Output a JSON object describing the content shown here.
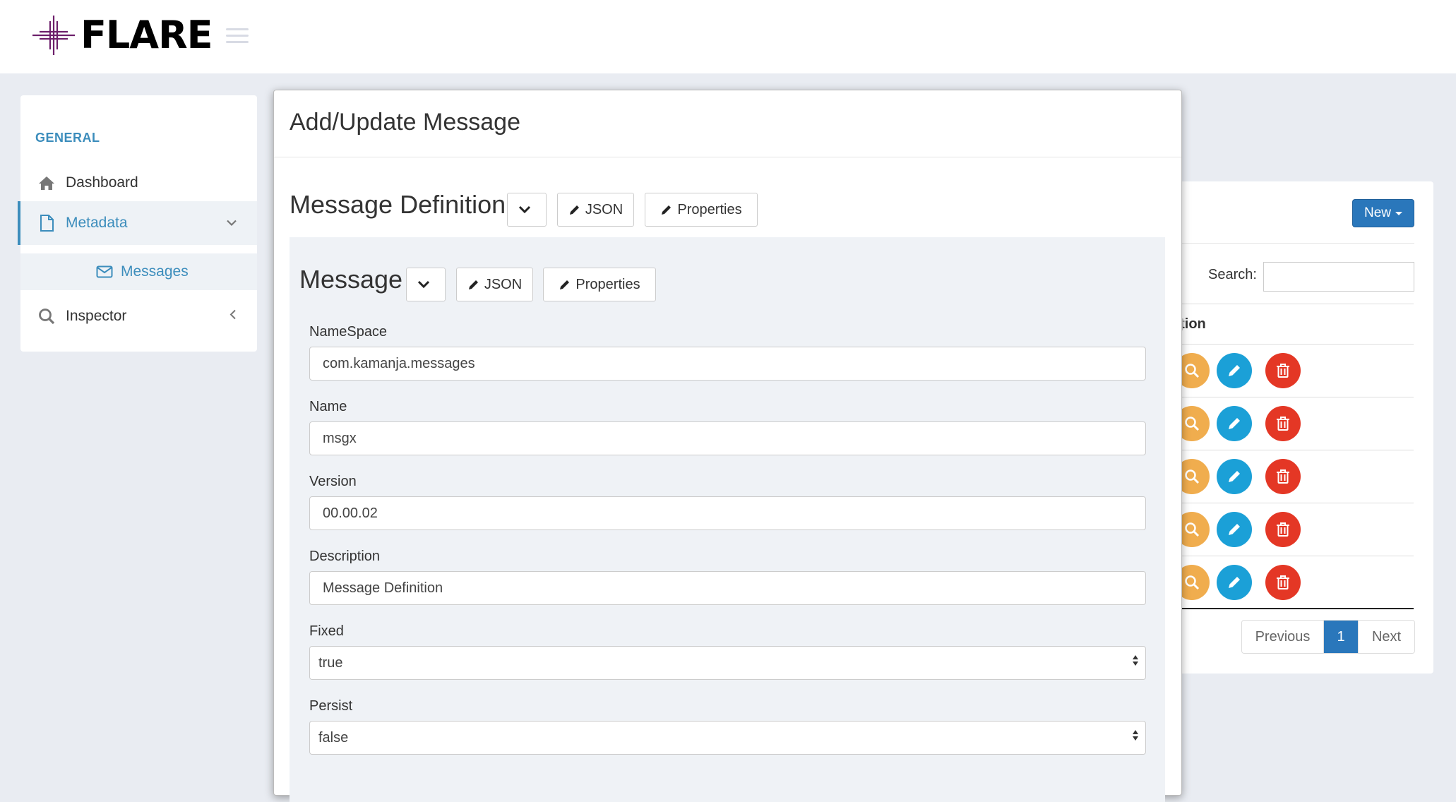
{
  "app": {
    "logo_text": "FLARE"
  },
  "sidebar": {
    "header": "GENERAL",
    "items": [
      {
        "label": "Dashboard",
        "icon": "home-icon"
      },
      {
        "label": "Metadata",
        "icon": "file-icon"
      },
      {
        "label": "Messages",
        "icon": "envelope-icon"
      },
      {
        "label": "Inspector",
        "icon": "search-icon"
      }
    ]
  },
  "background_table": {
    "new_label": "New",
    "search_label": "Search:",
    "search_value": "",
    "column_header": "ction",
    "row_count": 5,
    "pagination": {
      "previous": "Previous",
      "page": "1",
      "next": "Next"
    }
  },
  "modal": {
    "title": "Add/Update Message",
    "definition": {
      "title": "Message Definition",
      "json_label": "JSON",
      "properties_label": "Properties"
    },
    "message": {
      "title": "Message",
      "json_label": "JSON",
      "properties_label": "Properties"
    },
    "fields": {
      "namespace": {
        "label": "NameSpace",
        "value": "com.kamanja.messages"
      },
      "name": {
        "label": "Name",
        "value": "msgx"
      },
      "version": {
        "label": "Version",
        "value": "00.00.02"
      },
      "description": {
        "label": "Description",
        "value": "Message Definition"
      },
      "fixed": {
        "label": "Fixed",
        "value": "true"
      },
      "persist": {
        "label": "Persist",
        "value": "false"
      }
    }
  },
  "colors": {
    "primary": "#2a77bb",
    "view": "#f0ad4e",
    "edit": "#1ba0d7",
    "delete": "#e43725",
    "accent": "#3c8dbc"
  }
}
